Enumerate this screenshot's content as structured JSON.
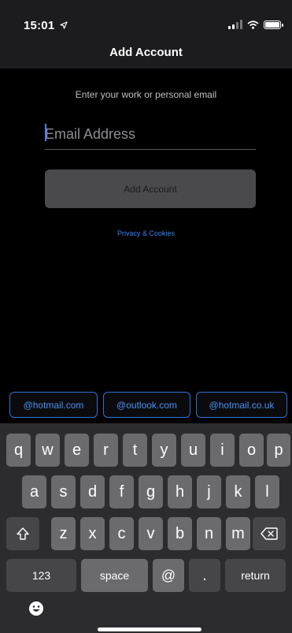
{
  "status_bar": {
    "time": "15:01"
  },
  "nav": {
    "title": "Add Account"
  },
  "form": {
    "subtitle": "Enter your work or personal email",
    "email_placeholder": "Email Address",
    "add_button": "Add Account",
    "privacy_link": "Privacy & Cookies"
  },
  "suggestions": [
    "@hotmail.com",
    "@outlook.com",
    "@hotmail.co.uk"
  ],
  "keyboard": {
    "row1": [
      "q",
      "w",
      "e",
      "r",
      "t",
      "y",
      "u",
      "i",
      "o",
      "p"
    ],
    "row2": [
      "a",
      "s",
      "d",
      "f",
      "g",
      "h",
      "j",
      "k",
      "l"
    ],
    "row3": [
      "z",
      "x",
      "c",
      "v",
      "b",
      "n",
      "m"
    ],
    "numbers_key": "123",
    "space_key": "space",
    "at_key": "@",
    "dot_key": ".",
    "return_key": "return",
    "shift_icon": "shift-icon",
    "backspace_icon": "backspace-icon",
    "emoji_icon": "emoji-icon"
  },
  "colors": {
    "accent": "#3b82f6",
    "chip_border": "#2f6fd6",
    "key": "#6b6b6e",
    "key_dark": "#464648"
  }
}
